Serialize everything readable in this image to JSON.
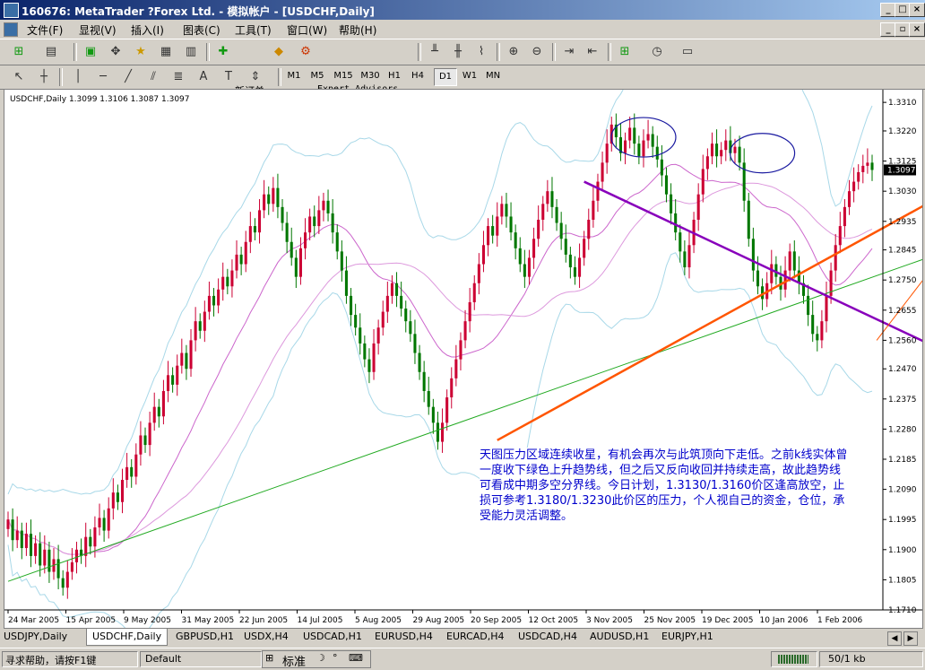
{
  "window": {
    "title": "160676: MetaTrader ?Forex Ltd. - 模拟帐户 - [USDCHF,Daily]"
  },
  "menu": [
    "文件(F)",
    "显视(V)",
    "插入(I)",
    "图表(C)",
    "工具(T)",
    "窗口(W)",
    "帮助(H)"
  ],
  "toolbar": {
    "new_order": "新订单",
    "expert_advisors": "Expert Advisors"
  },
  "timeframes": [
    "M1",
    "M5",
    "M15",
    "M30",
    "H1",
    "H4",
    "D1",
    "W1",
    "MN"
  ],
  "selected_timeframe": "D1",
  "chart": {
    "header": "USDCHF,Daily  1.3099 1.3106 1.3087 1.3097",
    "current_price": "1.3097",
    "price_labels": [
      "1.3310",
      "1.3220",
      "1.3125",
      "1.3030",
      "1.2935",
      "1.2845",
      "1.2750",
      "1.2655",
      "1.2560",
      "1.2470",
      "1.2375",
      "1.2280",
      "1.2185",
      "1.2090",
      "1.1995",
      "1.1900",
      "1.1805",
      "1.1710"
    ],
    "date_labels": [
      "24 Mar 2005",
      "15 Apr 2005",
      "9 May 2005",
      "31 May 2005",
      "22 Jun 2005",
      "14 Jul 2005",
      "5 Aug 2005",
      "29 Aug 2005",
      "20 Sep 2005",
      "12 Oct 2005",
      "3 Nov 2005",
      "25 Nov 2005",
      "19 Dec 2005",
      "10 Jan 2006",
      "1 Feb 2006"
    ],
    "annotation": "天图压力区域连续收星，有机会再次与此筑顶向下走低。之前k线实体曾一度收下绿色上升趋势线，但之后又反向收回并持续走高，故此趋势线可看成中期多空分界线。今日计划，1.3130/1.3160价区逢高放空，止损可参考1.3180/1.3230此价区的压力，个人视自己的资金，仓位，承受能力灵活调整。",
    "colors": {
      "bull": "#cc0033",
      "bear": "#007700",
      "bollinger": "#a8d8e8",
      "ma": "#cc66cc",
      "support": "#22aa22",
      "trend": "#ff5500",
      "resistance": "#8800bb",
      "circle": "#1a1aa0",
      "annotation_text": "#0000cc"
    }
  },
  "chart_data": {
    "type": "candlestick",
    "symbol": "USDCHF",
    "timeframe": "Daily",
    "ylim": [
      1.171,
      1.335
    ],
    "ohlc_last": {
      "open": 1.3099,
      "high": 1.3106,
      "low": 1.3087,
      "close": 1.3097
    },
    "closes": [
      1.1995,
      1.193,
      1.196,
      1.1905,
      1.195,
      1.188,
      1.192,
      1.185,
      1.19,
      1.183,
      1.187,
      1.181,
      1.178,
      1.183,
      1.186,
      1.19,
      1.188,
      1.194,
      1.191,
      1.197,
      1.2,
      1.196,
      1.203,
      1.208,
      1.205,
      1.212,
      1.216,
      1.213,
      1.22,
      1.226,
      1.223,
      1.23,
      1.235,
      1.232,
      1.24,
      1.245,
      1.242,
      1.248,
      1.252,
      1.247,
      1.256,
      1.262,
      1.259,
      1.265,
      1.27,
      1.267,
      1.272,
      1.276,
      1.273,
      1.278,
      1.283,
      1.28,
      1.287,
      1.292,
      1.29,
      1.297,
      1.302,
      1.299,
      1.304,
      1.298,
      1.293,
      1.287,
      1.282,
      1.276,
      1.285,
      1.29,
      1.295,
      1.292,
      1.297,
      1.3,
      1.296,
      1.29,
      1.284,
      1.278,
      1.27,
      1.264,
      1.26,
      1.255,
      1.25,
      1.246,
      1.255,
      1.26,
      1.265,
      1.27,
      1.274,
      1.27,
      1.266,
      1.262,
      1.258,
      1.252,
      1.246,
      1.24,
      1.235,
      1.23,
      1.224,
      1.23,
      1.238,
      1.244,
      1.25,
      1.256,
      1.262,
      1.268,
      1.274,
      1.28,
      1.286,
      1.292,
      1.289,
      1.295,
      1.299,
      1.295,
      1.29,
      1.285,
      1.28,
      1.276,
      1.282,
      1.288,
      1.294,
      1.299,
      1.303,
      1.298,
      1.293,
      1.288,
      1.283,
      1.279,
      1.276,
      1.282,
      1.288,
      1.294,
      1.3,
      1.306,
      1.312,
      1.318,
      1.324,
      1.32,
      1.315,
      1.319,
      1.323,
      1.318,
      1.314,
      1.319,
      1.321,
      1.317,
      1.313,
      1.308,
      1.302,
      1.296,
      1.29,
      1.284,
      1.279,
      1.286,
      1.294,
      1.302,
      1.31,
      1.314,
      1.318,
      1.314,
      1.316,
      1.319,
      1.315,
      1.317,
      1.312,
      1.3,
      1.288,
      1.278,
      1.273,
      1.269,
      1.274,
      1.28,
      1.276,
      1.272,
      1.278,
      1.284,
      1.278,
      1.274,
      1.27,
      1.264,
      1.258,
      1.256,
      1.262,
      1.27,
      1.278,
      1.286,
      1.292,
      1.298,
      1.303,
      1.306,
      1.309,
      1.311,
      1.312,
      1.3097
    ],
    "lines": [
      {
        "name": "",
        "from": [
          0,
          1.18
        ],
        "to": [
          207,
          1.285
        ]
      },
      {
        "name": "",
        "from": [
          107,
          1.2245
        ],
        "to": [
          230,
          1.322
        ]
      },
      {
        "name": "",
        "from": [
          126,
          1.306
        ],
        "to": [
          230,
          1.2355
        ]
      },
      {
        "name": "",
        "from": [
          190,
          1.256
        ],
        "to": [
          230,
          1.331
        ]
      }
    ]
  },
  "tabs": [
    "USDJPY,Daily",
    "USDCHF,Daily",
    "GBPUSD,H1",
    "USDX,H4",
    "USDCAD,H1",
    "EURUSD,H4",
    "EURCAD,H4",
    "USDCAD,H4",
    "AUDUSD,H1",
    "EURJPY,H1"
  ],
  "active_tab": "USDCHF,Daily",
  "status": {
    "help": "寻求帮助，请按F1键",
    "profile": "Default",
    "ime": "标准",
    "traffic": "50/1 kb"
  }
}
